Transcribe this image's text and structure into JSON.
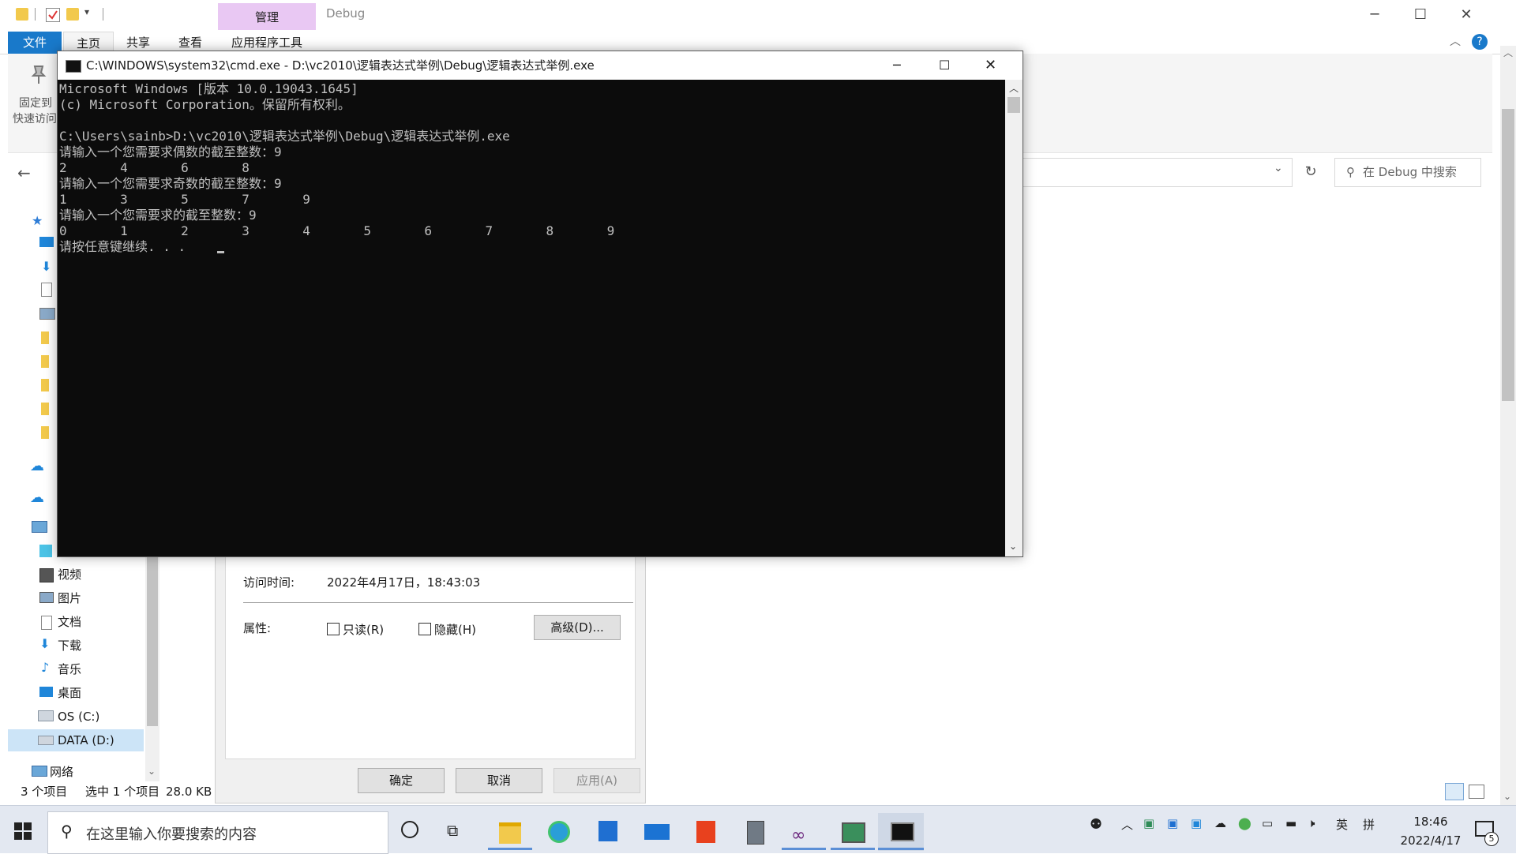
{
  "explorer": {
    "contextual_tab": "管理",
    "window_title": "Debug",
    "ribbon_tabs": [
      {
        "label": "文件"
      },
      {
        "label": "主页"
      },
      {
        "label": "共享"
      },
      {
        "label": "查看"
      },
      {
        "label": "应用程序工具"
      }
    ],
    "pin_label_line1": "固定到",
    "pin_label_line2": "快速访问",
    "search_placeholder": "在 Debug 中搜索",
    "nav_items": [
      {
        "label": "3D 对象"
      },
      {
        "label": "视频"
      },
      {
        "label": "图片"
      },
      {
        "label": "文档"
      },
      {
        "label": "下载"
      },
      {
        "label": "音乐"
      },
      {
        "label": "桌面"
      },
      {
        "label": "OS (C:)"
      },
      {
        "label": "DATA (D:)"
      },
      {
        "label": "网络"
      }
    ],
    "status": {
      "item_count": "3 个项目",
      "selected": "选中 1 个项目",
      "size": "28.0 KB"
    }
  },
  "properties_dialog": {
    "access_time_label": "访问时间:",
    "access_time_value": "2022年4月17日，18:43:03",
    "attributes_label": "属性:",
    "readonly_label": "只读(R)",
    "hidden_label": "隐藏(H)",
    "advanced_button": "高级(D)...",
    "ok_button": "确定",
    "cancel_button": "取消",
    "apply_button": "应用(A)"
  },
  "cmd": {
    "title": "C:\\WINDOWS\\system32\\cmd.exe - D:\\vc2010\\逻辑表达式举例\\Debug\\逻辑表达式举例.exe",
    "lines": [
      "Microsoft Windows [版本 10.0.19043.1645]",
      "(c) Microsoft Corporation。保留所有权利。",
      "",
      "C:\\Users\\sainb>D:\\vc2010\\逻辑表达式举例\\Debug\\逻辑表达式举例.exe",
      "请输入一个您需要求偶数的截至整数：9",
      "2       4       6       8",
      "请输入一个您需要求奇数的截至整数：9",
      "1       3       5       7       9",
      "请输入一个您需要求的截至整数：9",
      "0       1       2       3       4       5       6       7       8       9",
      "请按任意键继续. . . "
    ]
  },
  "taskbar": {
    "search_placeholder": "在这里输入你要搜索的内容",
    "time": "18:46",
    "date": "2022/4/17",
    "ime_lang": "英",
    "ime_mode": "拼",
    "notification_count": "5"
  }
}
